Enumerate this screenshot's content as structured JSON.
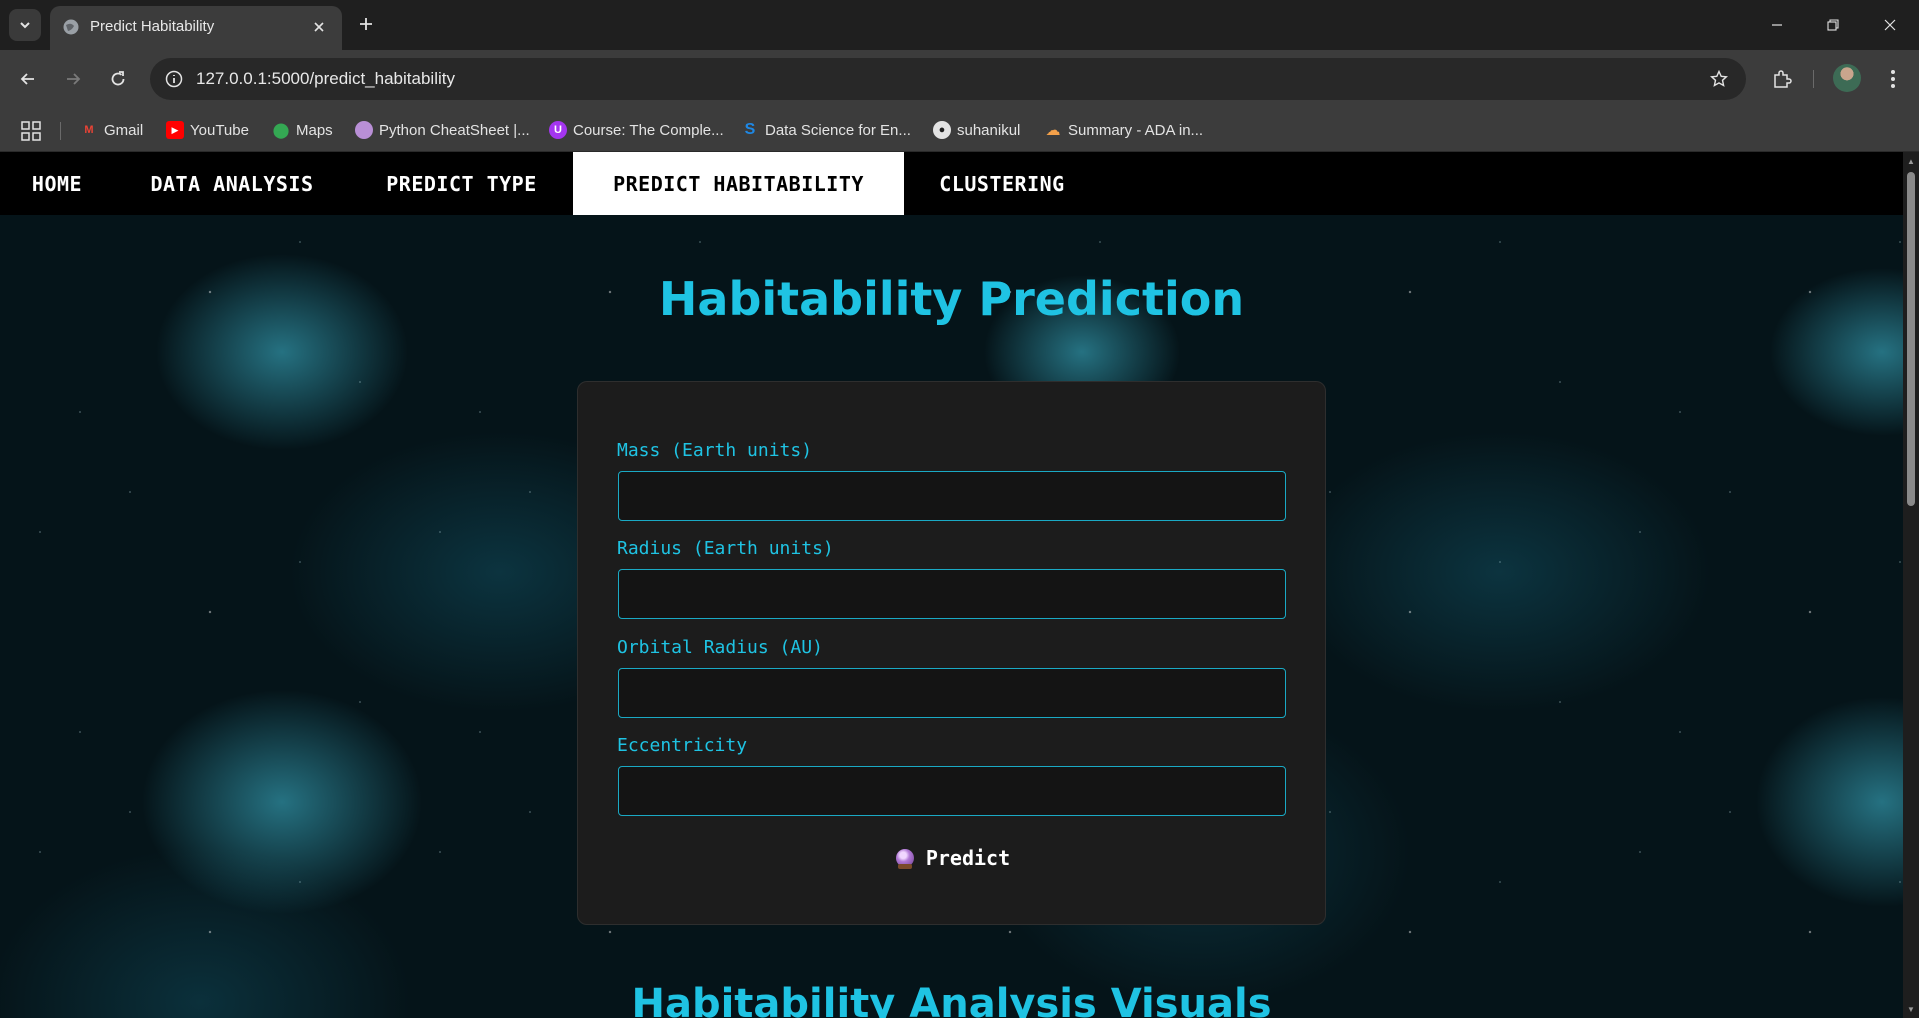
{
  "browser": {
    "tab_title": "Predict Habitability",
    "url": "127.0.0.1:5000/predict_habitability",
    "bookmarks": [
      {
        "label": "Gmail",
        "icon": "gmail-icon"
      },
      {
        "label": "YouTube",
        "icon": "youtube-icon"
      },
      {
        "label": "Maps",
        "icon": "maps-icon"
      },
      {
        "label": "Python CheatSheet |...",
        "icon": "python-cheatsheet-icon"
      },
      {
        "label": "Course: The Comple...",
        "icon": "udemy-icon"
      },
      {
        "label": "Data Science for En...",
        "icon": "data-science-icon"
      },
      {
        "label": "suhanikul",
        "icon": "github-icon"
      },
      {
        "label": "Summary - ADA in...",
        "icon": "summary-icon"
      }
    ]
  },
  "site_nav": {
    "items": [
      {
        "label": "HOME",
        "active": false
      },
      {
        "label": "DATA ANALYSIS",
        "active": false
      },
      {
        "label": "PREDICT TYPE",
        "active": false
      },
      {
        "label": "PREDICT HABITABILITY",
        "active": true
      },
      {
        "label": "CLUSTERING",
        "active": false
      }
    ]
  },
  "main": {
    "title": "Habitability Prediction",
    "form": {
      "fields": [
        {
          "label": "Mass (Earth units)",
          "value": ""
        },
        {
          "label": "Radius (Earth units)",
          "value": ""
        },
        {
          "label": "Orbital Radius (AU)",
          "value": ""
        },
        {
          "label": "Eccentricity",
          "value": ""
        }
      ],
      "submit_label": "Predict"
    },
    "section_title": "Habitability Analysis Visuals"
  },
  "colors": {
    "accent": "#1fc3e3",
    "nav_bg": "#000000",
    "card_bg": "#1c1c1c"
  }
}
